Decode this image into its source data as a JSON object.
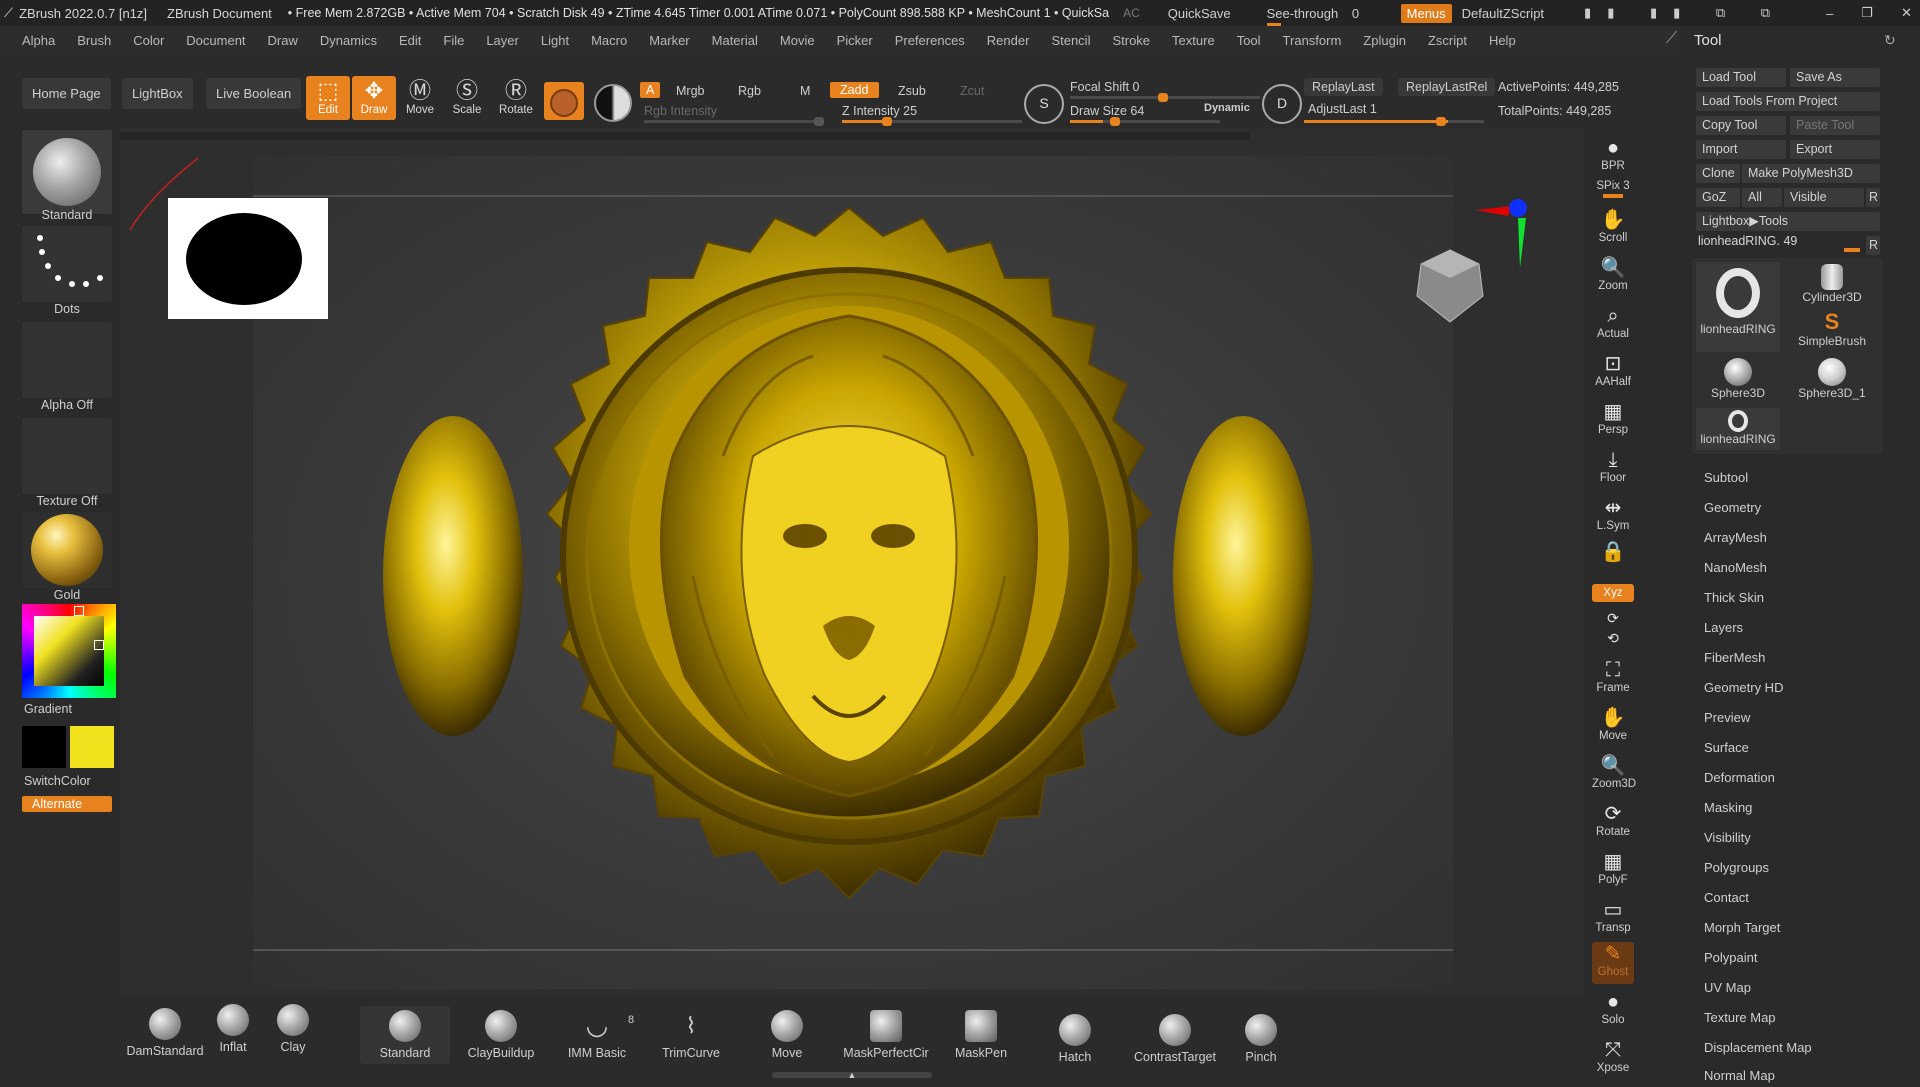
{
  "titlebar": {
    "app": "ZBrush 2022.0.7 [n1z]",
    "doc": "ZBrush Document",
    "stats": "• Free Mem 2.872GB • Active Mem 704 • Scratch Disk 49 • ZTime 4.645 Timer 0.001 ATime 0.071 • PolyCount 898.588 KP • MeshCount 1 • QuickSa",
    "ac": "AC",
    "quicksave": "QuickSave",
    "seethrough": "See-through",
    "seethrough_value": "0",
    "menus": "Menus",
    "zscript": "DefaultZScript"
  },
  "menubar": [
    "Alpha",
    "Brush",
    "Color",
    "Document",
    "Draw",
    "Dynamics",
    "Edit",
    "File",
    "Layer",
    "Light",
    "Macro",
    "Marker",
    "Material",
    "Movie",
    "Picker",
    "Preferences",
    "Render",
    "Stencil",
    "Stroke",
    "Texture",
    "Tool",
    "Transform",
    "Zplugin",
    "Zscript",
    "Help"
  ],
  "toolbar": {
    "home_page": "Home Page",
    "lightbox": "LightBox",
    "live_boolean": "Live Boolean",
    "edit": "Edit",
    "draw": "Draw",
    "move": "Move",
    "scale": "Scale",
    "rotate": "Rotate",
    "a": "A",
    "mrgb": "Mrgb",
    "rgb": "Rgb",
    "m": "M",
    "zadd": "Zadd",
    "zsub": "Zsub",
    "zcut": "Zcut",
    "rgb_intensity": "Rgb Intensity",
    "z_intensity": "Z Intensity 25",
    "z_intensity_value": 25,
    "focal_shift": "Focal Shift 0",
    "draw_size": "Draw Size 64",
    "dynamic": "Dynamic",
    "replay_last": "ReplayLast",
    "replay_last_rel": "ReplayLastRel",
    "adjust_last": "AdjustLast 1",
    "active_points": "ActivePoints: 449,285",
    "total_points": "TotalPoints: 449,285"
  },
  "left": {
    "standard": "Standard",
    "dots": "Dots",
    "alpha_off": "Alpha Off",
    "texture_off": "Texture Off",
    "gold": "Gold",
    "gradient": "Gradient",
    "switchcolor": "SwitchColor",
    "alternate": "Alternate",
    "primary_color": "#000000",
    "secondary_color": "#f2e21e"
  },
  "right_strip": [
    "BPR",
    "SPix 3",
    "Scroll",
    "Zoom",
    "Actual",
    "AAHalf",
    "Persp",
    "Floor",
    "L.Sym",
    "",
    "Xyz",
    "",
    "",
    "Frame",
    "Move",
    "Zoom3D",
    "Rotate",
    "PolyF",
    "Transp",
    "Ghost",
    "Solo",
    "Xpose"
  ],
  "tool_panel": {
    "title": "Tool",
    "load_tool": "Load Tool",
    "save_as": "Save As",
    "load_from_project": "Load Tools From Project",
    "copy_tool": "Copy Tool",
    "paste_tool": "Paste Tool",
    "import": "Import",
    "export": "Export",
    "clone": "Clone",
    "make_polymesh": "Make PolyMesh3D",
    "goz": "GoZ",
    "all": "All",
    "visible": "Visible",
    "r": "R",
    "lightbox_tools": "Lightbox▶Tools",
    "current_tool": "lionheadRING. 49",
    "thumbs": [
      "lionheadRING",
      "Cylinder3D",
      "SimpleBrush",
      "Sphere3D",
      "Sphere3D_1",
      "lionheadRING"
    ],
    "sections": [
      "Subtool",
      "Geometry",
      "ArrayMesh",
      "NanoMesh",
      "Thick Skin",
      "Layers",
      "FiberMesh",
      "Geometry HD",
      "Preview",
      "Surface",
      "Deformation",
      "Masking",
      "Visibility",
      "Polygroups",
      "Contact",
      "Morph Target",
      "Polypaint",
      "UV Map",
      "Texture Map",
      "Displacement Map",
      "Normal Map"
    ]
  },
  "bottom_brushes": [
    "DamStandard",
    "Inflat",
    "Clay",
    "Standard",
    "ClayBuildup",
    "IMM Basic",
    "TrimCurve",
    "Move",
    "MaskPerfectCir",
    "MaskPen",
    "Hatch",
    "ContrastTarget",
    "Pinch"
  ],
  "imm_count": "8",
  "accent": "#e8821e"
}
